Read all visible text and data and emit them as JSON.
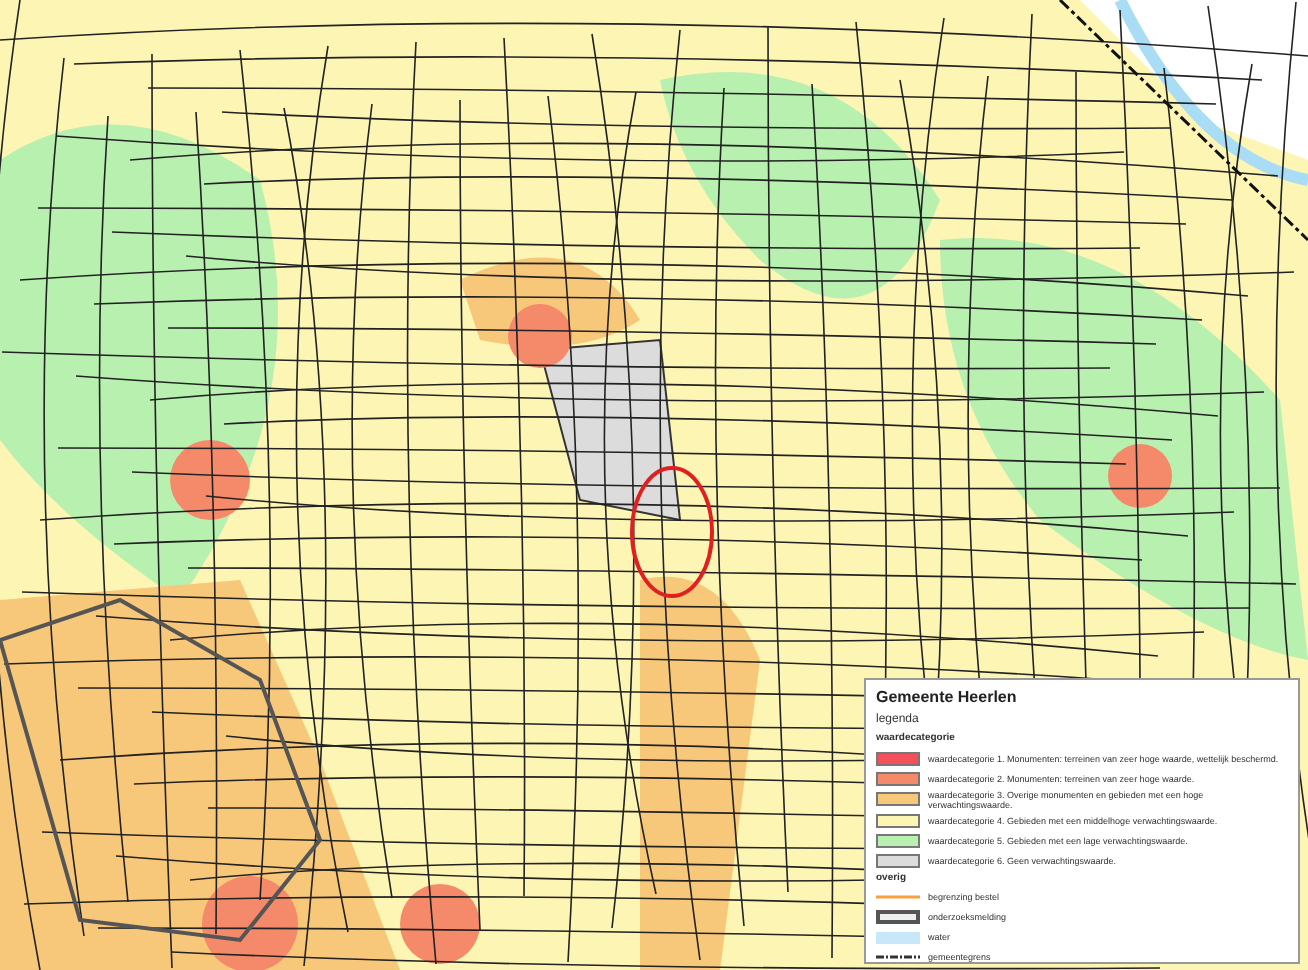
{
  "legend": {
    "title": "Gemeente Heerlen",
    "subtitle": "legenda",
    "sections": [
      {
        "heading": "waardecategorie",
        "items": [
          {
            "kind": "fill",
            "color": "#f4505a",
            "label": "waardecategorie 1. Monumenten: terreinen van zeer hoge waarde, wettelijk beschermd."
          },
          {
            "kind": "fill",
            "color": "#f58a6a",
            "label": "waardecategorie 2. Monumenten: terreinen van zeer hoge waarde."
          },
          {
            "kind": "fill",
            "color": "#f8c87a",
            "label": "waardecategorie 3. Overige monumenten en gebieden met een hoge verwachtingswaarde."
          },
          {
            "kind": "fill",
            "color": "#fdf5b4",
            "label": "waardecategorie 4. Gebieden met een middelhoge verwachtingswaarde."
          },
          {
            "kind": "fill",
            "color": "#b8f0b0",
            "label": "waardecategorie 5. Gebieden met een lage verwachtingswaarde."
          },
          {
            "kind": "fill",
            "color": "#dcdcdc",
            "label": "waardecategorie 6. Geen verwachtingswaarde."
          }
        ]
      },
      {
        "heading": "overig",
        "items": [
          {
            "kind": "line",
            "color": "#f7a040",
            "label": "begrenzing bestel"
          },
          {
            "kind": "hatch",
            "color": "#555555",
            "label": "onderzoeksmelding"
          },
          {
            "kind": "water",
            "color": "#c8e8fa",
            "label": "water"
          },
          {
            "kind": "dash",
            "color": "#333333",
            "label": "gemeentegrens"
          }
        ]
      }
    ]
  }
}
